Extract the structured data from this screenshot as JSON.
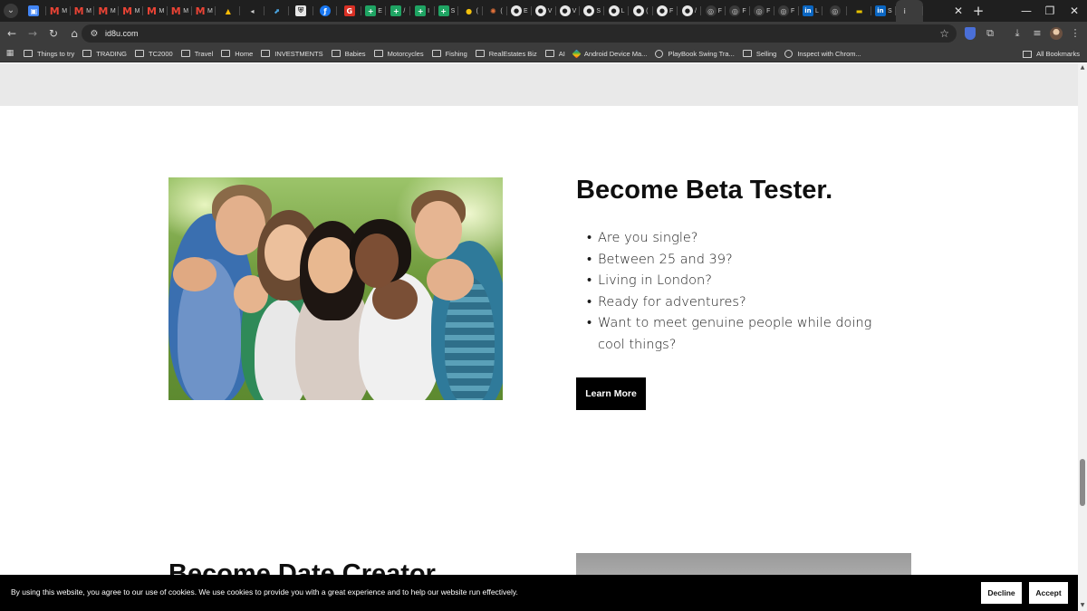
{
  "browser": {
    "tabs": [
      {
        "icon": "google-docs-icon",
        "label": ""
      },
      {
        "icon": "gmail-icon",
        "label": "M"
      },
      {
        "icon": "gmail-icon",
        "label": "M"
      },
      {
        "icon": "gmail-icon",
        "label": "M"
      },
      {
        "icon": "gmail-icon",
        "label": "M"
      },
      {
        "icon": "gmail-icon",
        "label": "M"
      },
      {
        "icon": "gmail-icon",
        "label": "M"
      },
      {
        "icon": "gmail-icon",
        "label": "M"
      },
      {
        "icon": "google-drive-icon",
        "label": ""
      },
      {
        "icon": "audio-icon",
        "label": ""
      },
      {
        "icon": "app-icon",
        "label": ""
      },
      {
        "icon": "shield-icon",
        "label": ""
      },
      {
        "icon": "info-icon",
        "label": ""
      },
      {
        "icon": "red-app-icon",
        "label": ""
      },
      {
        "icon": "sheets-icon",
        "label": "E"
      },
      {
        "icon": "sheets-icon",
        "label": "/"
      },
      {
        "icon": "sheets-icon",
        "label": "I"
      },
      {
        "icon": "sheets-icon",
        "label": "S"
      },
      {
        "icon": "yellow-circle-icon",
        "label": "("
      },
      {
        "icon": "sparkle-icon",
        "label": "("
      },
      {
        "icon": "github-icon",
        "label": "E"
      },
      {
        "icon": "github-icon",
        "label": "V"
      },
      {
        "icon": "github-icon",
        "label": "V"
      },
      {
        "icon": "github-icon",
        "label": "S"
      },
      {
        "icon": "github-icon",
        "label": "L"
      },
      {
        "icon": "github-icon",
        "label": "("
      },
      {
        "icon": "github-icon",
        "label": "F"
      },
      {
        "icon": "github-icon",
        "label": "/"
      },
      {
        "icon": "globe-icon",
        "label": "F"
      },
      {
        "icon": "globe-icon",
        "label": "F"
      },
      {
        "icon": "globe-icon",
        "label": "F"
      },
      {
        "icon": "globe-icon",
        "label": "F"
      },
      {
        "icon": "linkedin-icon",
        "label": "L"
      },
      {
        "icon": "globe-icon",
        "label": ""
      },
      {
        "icon": "colorbar-icon",
        "label": ""
      },
      {
        "icon": "linkedin-icon",
        "label": "S"
      }
    ],
    "active_tab_label": "i",
    "address": "id8u.com",
    "bookmarks": [
      {
        "label": "Things to try",
        "icon": "folder-icon"
      },
      {
        "label": "TRADING",
        "icon": "folder-icon"
      },
      {
        "label": "TC2000",
        "icon": "folder-icon"
      },
      {
        "label": "Travel",
        "icon": "folder-icon"
      },
      {
        "label": "Home",
        "icon": "folder-icon"
      },
      {
        "label": "INVESTMENTS",
        "icon": "folder-icon"
      },
      {
        "label": "Babies",
        "icon": "folder-icon"
      },
      {
        "label": "Motorcycles",
        "icon": "folder-icon"
      },
      {
        "label": "Fishing",
        "icon": "folder-icon"
      },
      {
        "label": "RealEstates Biz",
        "icon": "folder-icon"
      },
      {
        "label": "AI",
        "icon": "folder-icon"
      },
      {
        "label": "Android Device Ma...",
        "icon": "android-icon"
      },
      {
        "label": "PlayBook Swing Tra...",
        "icon": "globe-icon"
      },
      {
        "label": "Selling",
        "icon": "folder-icon"
      },
      {
        "label": "Inspect with Chrom...",
        "icon": "globe-icon"
      }
    ],
    "all_bookmarks": "All Bookmarks"
  },
  "page": {
    "heading": "Become Beta Tester.",
    "questions": [
      "Are you single?",
      "Between 25 and 39?",
      "Living in London?",
      "Ready for adventures?",
      "Want to meet genuine people while doing cool things?"
    ],
    "cta": "Learn More",
    "next_heading": "Become Date Creator"
  },
  "cookie": {
    "text": "By using this website, you agree to our use of cookies. We use cookies to provide you with a great experience and to help our website run effectively.",
    "decline": "Decline",
    "accept": "Accept"
  }
}
